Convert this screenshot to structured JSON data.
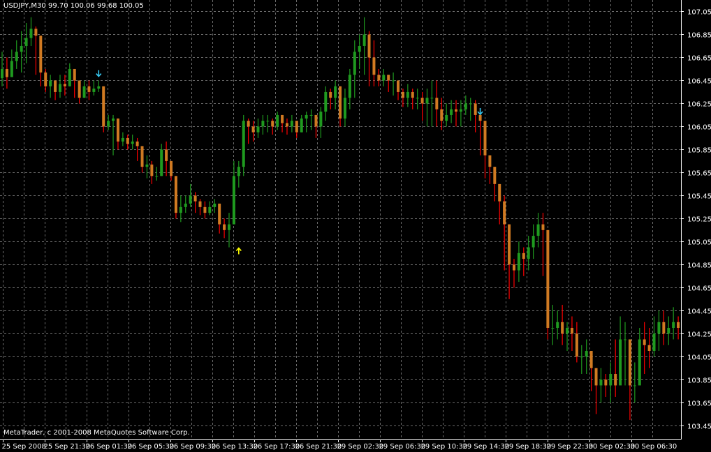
{
  "header": {
    "symbol": "USDJPY,M30",
    "ohlc": "99.70 100.06 99.68 100.05"
  },
  "footer": {
    "copyright": "MetaTrader, c 2001-2008 MetaQuotes Software Corp."
  },
  "colors": {
    "background": "#000000",
    "grid": "#6b6b6b",
    "axis": "#ffffff",
    "bull": "#1f9a1f",
    "bear": "#ff0000",
    "body_orange": "#d07a22",
    "arrow_down": "#36c8f0",
    "arrow_up": "#ffff00"
  },
  "chart_data": {
    "type": "candlestick",
    "title": "",
    "xlabel": "",
    "ylabel": "",
    "ylim": [
      103.33,
      107.15
    ],
    "y_ticks": [
      "107.05",
      "106.85",
      "106.65",
      "106.45",
      "106.25",
      "106.05",
      "105.85",
      "105.65",
      "105.45",
      "105.25",
      "105.05",
      "104.85",
      "104.65",
      "104.45",
      "104.25",
      "104.05",
      "103.85",
      "103.65",
      "103.45"
    ],
    "x_ticks": [
      "25 Sep 2008",
      "25 Sep 21:30",
      "26 Sep 01:30",
      "26 Sep 05:30",
      "26 Sep 09:30",
      "26 Sep 13:30",
      "26 Sep 17:30",
      "26 Sep 21:30",
      "29 Sep 02:30",
      "29 Sep 06:30",
      "29 Sep 10:30",
      "29 Sep 14:30",
      "29 Sep 18:30",
      "29 Sep 22:30",
      "30 Sep 02:30",
      "30 Sep 06:30"
    ],
    "grid": true,
    "series": [
      {
        "close": [
          106.55,
          106.48,
          106.62,
          106.7,
          106.75,
          106.82,
          106.9,
          106.84,
          106.52,
          106.4,
          106.45,
          106.35,
          106.42,
          106.4,
          106.55,
          106.45,
          106.3,
          106.4,
          106.35,
          106.38,
          106.4,
          106.05,
          106.1,
          106.12,
          105.92,
          105.95,
          105.9,
          105.92,
          105.88,
          105.7,
          105.72,
          105.62,
          105.62,
          105.85,
          105.75,
          105.62,
          105.3,
          105.35,
          105.38,
          105.45,
          105.4,
          105.35,
          105.3,
          105.35,
          105.38,
          105.2,
          105.15,
          105.2,
          105.62,
          105.7,
          106.1,
          106.05,
          106.0,
          106.05,
          106.1,
          106.1,
          106.05,
          106.15,
          106.08,
          106.05,
          106.1,
          106.0,
          106.12,
          106.15,
          106.15,
          106.05,
          106.18,
          106.35,
          106.3,
          106.4,
          106.12,
          106.3,
          106.5,
          106.7,
          106.75,
          106.85,
          106.65,
          106.5,
          106.45,
          106.5,
          106.45,
          106.45,
          106.35,
          106.3,
          106.35,
          106.3,
          106.3,
          106.25,
          106.3,
          106.3,
          106.2,
          106.1,
          106.15,
          106.2,
          106.18,
          106.2,
          106.25,
          106.25,
          106.15,
          106.1,
          105.8,
          105.7,
          105.55,
          105.4,
          105.2,
          104.85,
          104.8,
          104.95,
          104.9,
          105.0,
          105.1,
          105.2,
          105.15,
          104.3,
          104.3,
          104.35,
          104.25,
          104.3,
          104.25,
          104.05,
          104.05,
          104.1,
          103.95,
          103.8,
          103.85,
          103.8,
          103.9,
          103.8,
          104.2,
          104.2,
          103.8,
          103.8,
          104.2,
          104.15,
          104.1,
          104.25,
          104.35,
          104.25,
          104.3,
          104.35,
          104.3
        ],
        "high": [
          106.7,
          106.65,
          106.72,
          106.8,
          106.88,
          106.95,
          107.0,
          106.92,
          106.6,
          106.55,
          106.5,
          106.45,
          106.5,
          106.5,
          106.6,
          106.55,
          106.4,
          106.45,
          106.45,
          106.45,
          106.45,
          106.38,
          106.15,
          106.15,
          106.05,
          106.0,
          105.98,
          105.98,
          105.95,
          105.85,
          105.8,
          105.75,
          105.7,
          105.9,
          105.92,
          105.7,
          105.62,
          105.45,
          105.45,
          105.55,
          105.48,
          105.42,
          105.4,
          105.4,
          105.42,
          105.3,
          105.25,
          105.3,
          105.75,
          105.75,
          106.15,
          106.12,
          106.1,
          106.12,
          106.15,
          106.15,
          106.12,
          106.18,
          106.15,
          106.12,
          106.15,
          106.08,
          106.15,
          106.18,
          106.2,
          106.12,
          106.22,
          106.4,
          106.38,
          106.45,
          106.4,
          106.38,
          106.55,
          106.8,
          106.85,
          107.0,
          106.88,
          106.8,
          106.55,
          106.55,
          106.5,
          106.52,
          106.45,
          106.38,
          106.42,
          106.38,
          106.38,
          106.35,
          106.38,
          106.45,
          106.45,
          106.3,
          106.25,
          106.28,
          106.28,
          106.28,
          106.32,
          106.3,
          106.28,
          106.15,
          105.92,
          105.75,
          105.65,
          105.55,
          105.45,
          104.95,
          104.9,
          105.05,
          105.0,
          105.1,
          105.2,
          105.3,
          105.3,
          104.6,
          104.5,
          104.45,
          104.5,
          104.35,
          104.4,
          104.35,
          104.15,
          104.2,
          104.05,
          103.95,
          103.95,
          103.9,
          104.0,
          104.2,
          104.4,
          104.35,
          103.9,
          104.0,
          104.3,
          104.35,
          104.3,
          104.4,
          104.45,
          104.45,
          104.4,
          104.48,
          104.4
        ],
        "low": [
          106.4,
          106.38,
          106.48,
          106.55,
          106.52,
          106.6,
          106.75,
          106.5,
          106.4,
          106.35,
          106.3,
          106.28,
          106.3,
          106.32,
          106.4,
          106.3,
          106.25,
          106.3,
          106.28,
          106.32,
          106.35,
          106.0,
          106.02,
          105.8,
          105.85,
          105.88,
          105.85,
          105.85,
          105.75,
          105.65,
          105.6,
          105.55,
          105.58,
          105.65,
          105.62,
          105.58,
          105.25,
          105.22,
          105.3,
          105.35,
          105.3,
          105.28,
          105.25,
          105.28,
          105.3,
          105.12,
          105.08,
          105.0,
          105.2,
          105.52,
          105.62,
          105.9,
          105.92,
          105.95,
          105.98,
          106.0,
          105.98,
          106.02,
          106.0,
          105.98,
          106.0,
          105.95,
          106.0,
          106.0,
          106.02,
          105.95,
          105.95,
          106.1,
          106.2,
          106.2,
          106.05,
          106.05,
          106.2,
          106.3,
          106.55,
          106.5,
          106.4,
          106.4,
          106.4,
          106.4,
          106.35,
          106.32,
          106.28,
          106.22,
          106.22,
          106.2,
          106.2,
          106.1,
          106.05,
          106.05,
          106.05,
          106.02,
          106.05,
          106.08,
          106.05,
          106.05,
          106.15,
          106.1,
          106.0,
          105.8,
          105.6,
          105.55,
          105.4,
          105.2,
          104.8,
          104.55,
          104.65,
          104.7,
          104.75,
          104.8,
          104.9,
          105.0,
          104.75,
          104.2,
          104.15,
          104.2,
          104.15,
          104.1,
          104.1,
          104.0,
          103.9,
          103.9,
          103.75,
          103.55,
          103.65,
          103.7,
          103.65,
          103.7,
          103.95,
          103.8,
          103.5,
          103.65,
          103.8,
          103.9,
          103.95,
          104.05,
          104.1,
          104.15,
          104.15,
          104.2,
          104.2
        ],
        "signals": [
          {
            "index": 20,
            "dir": "down",
            "price": 106.51
          },
          {
            "index": 49,
            "dir": "up",
            "price": 104.97
          },
          {
            "index": 99,
            "dir": "down",
            "price": 106.18
          }
        ]
      }
    ]
  }
}
